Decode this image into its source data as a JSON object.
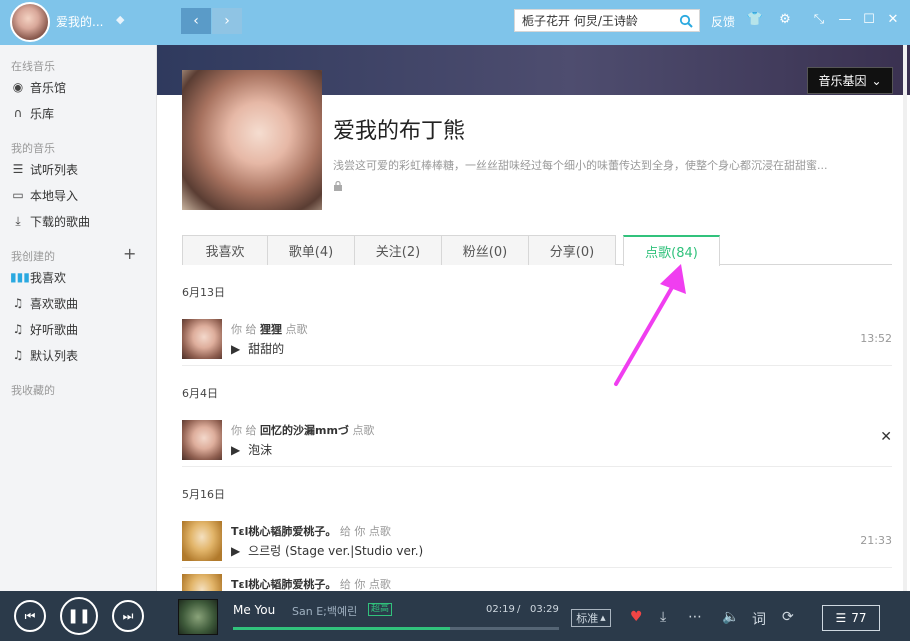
{
  "header": {
    "username": "爱我的...",
    "search_value": "栀子花开 何炅/王诗龄",
    "feedback": "反馈"
  },
  "sidebar": {
    "sections": [
      {
        "label": "在线音乐"
      },
      {
        "label": "我的音乐"
      },
      {
        "label": "我创建的"
      },
      {
        "label": "我收藏的"
      }
    ],
    "items": [
      {
        "label": "音乐馆",
        "icon": "music-hall-icon"
      },
      {
        "label": "乐库",
        "icon": "headphones-icon"
      },
      {
        "label": "试听列表",
        "icon": "list-icon"
      },
      {
        "label": "本地导入",
        "icon": "monitor-icon"
      },
      {
        "label": "下载的歌曲",
        "icon": "download-icon"
      },
      {
        "label": "我喜欢",
        "icon": "equalizer-icon"
      },
      {
        "label": "喜欢歌曲",
        "icon": "note-icon"
      },
      {
        "label": "好听歌曲",
        "icon": "note-icon"
      },
      {
        "label": "默认列表",
        "icon": "note-icon"
      }
    ]
  },
  "profile": {
    "gene_button": "音乐基因",
    "name": "爱我的布丁熊",
    "description": "浅尝这可爱的彩虹棒棒糖，一丝丝甜味经过每个细小的味蕾传达到全身，使整个身心都沉浸在甜甜蜜..."
  },
  "tabs": [
    {
      "label": "我喜欢"
    },
    {
      "label": "歌单(4)"
    },
    {
      "label": "关注(2)"
    },
    {
      "label": "粉丝(0)"
    },
    {
      "label": "分享(0)"
    },
    {
      "label": "点歌(84)"
    }
  ],
  "feed": {
    "groups": [
      {
        "date": "6月13日",
        "entry": {
          "you": "你",
          "give": "给",
          "name": "狸狸",
          "action": "点歌",
          "song": "甜甜的",
          "time": "13:52"
        }
      },
      {
        "date": "6月4日",
        "entry": {
          "you": "你",
          "give": "给",
          "name": "回忆的沙漏mmづ",
          "action": "点歌",
          "song": "泡沫",
          "time": ""
        }
      },
      {
        "date": "5月16日",
        "entry": {
          "name": "Tεl桃心韬肺爱桃子。",
          "give": "给",
          "you": "你",
          "action": "点歌",
          "song": "으르렁 (Stage ver.|Studio ver.)",
          "time": "21:33"
        }
      },
      {
        "entry": {
          "name": "Tεl桃心韬肺爱桃子。",
          "give": "给",
          "you": "你",
          "action": "点歌"
        }
      }
    ]
  },
  "player": {
    "song_title": "Me You",
    "artist": "San E;백예린",
    "quality_badge": "超高",
    "time_current": "02:19",
    "time_sep": "/",
    "time_total": "03:29",
    "progress": 0.666,
    "quality_select": "标准",
    "playlist_count": "77"
  },
  "colors": {
    "topbar": "#7fc4ea",
    "accent_green": "#31c27c",
    "player_bg": "#2b3a4a",
    "arrow": "#f03ef0"
  }
}
